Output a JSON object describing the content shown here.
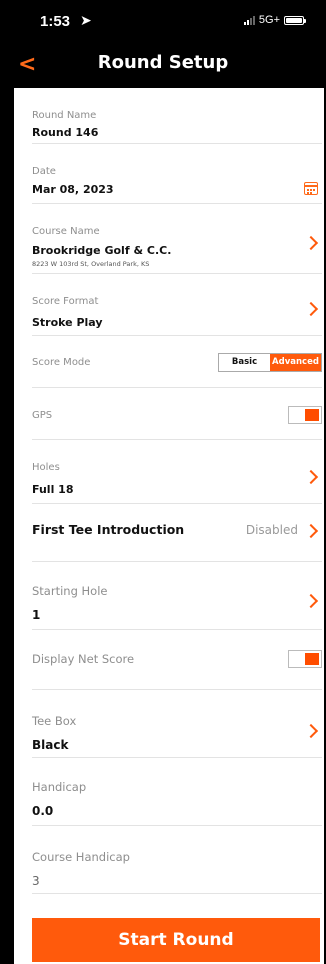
{
  "status_bar": {
    "time": "1:53",
    "network": "5G+"
  },
  "nav": {
    "title": "Round Setup"
  },
  "round_name": {
    "label": "Round Name",
    "value": "Round 146"
  },
  "date": {
    "label": "Date",
    "value": "Mar 08, 2023"
  },
  "course": {
    "label": "Course Name",
    "value": "Brookridge Golf & C.C.",
    "address": "8223 W 103rd St, Overland Park, KS"
  },
  "score_format": {
    "label": "Score Format",
    "value": "Stroke Play"
  },
  "score_mode": {
    "label": "Score Mode",
    "options": [
      "Basic",
      "Advanced"
    ],
    "selected": "Advanced"
  },
  "gps": {
    "label": "GPS",
    "enabled": true
  },
  "holes": {
    "label": "Holes",
    "value": "Full 18"
  },
  "first_tee": {
    "label": "First Tee Introduction",
    "value": "Disabled"
  },
  "starting_hole": {
    "label": "Starting Hole",
    "value": "1"
  },
  "net_score": {
    "label": "Display Net Score",
    "enabled": true
  },
  "tee_box": {
    "label": "Tee Box",
    "value": "Black"
  },
  "handicap": {
    "label": "Handicap",
    "value": "0.0"
  },
  "course_handicap": {
    "label": "Course Handicap",
    "value": "3"
  },
  "start_button": {
    "label": "Start Round"
  },
  "colors": {
    "accent": "#ff5a0c",
    "background": "#000000",
    "panel": "#ffffff"
  }
}
